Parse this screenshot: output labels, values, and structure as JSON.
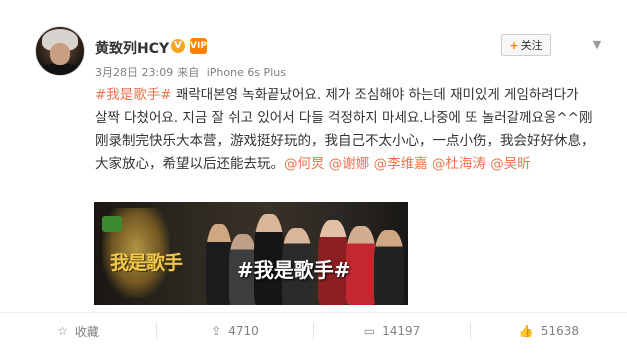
{
  "header": {
    "username": "黄致列HCY",
    "verified_badge": "V",
    "vip_badge": "VIP",
    "timestamp": "3月28日 23:09",
    "source_prefix": "来自",
    "source_device": "iPhone 6s Plus",
    "follow_label": "关注",
    "chevron_icon": "chevron-down-icon"
  },
  "post": {
    "hashtag": "#我是歌手#",
    "korean_text": " 쾌락대본영 녹화끝났어요. 제가 조심해야 하는데 재미있게 게임하려다가 살짝 다쳤어요. 지금 잘 쉬고 있어서 다들 걱정하지 마세요.나중에 또 놀러갈께요옹^^",
    "chinese_text": "刚刚录制完快乐大本营，游戏挺好玩的，我自己不太小心，一点小伤，我会好好休息，大家放心，希望以后还能去玩。",
    "mentions": [
      "@何炅",
      "@谢娜",
      "@李维嘉",
      "@杜海涛",
      "@吴昕"
    ]
  },
  "media": {
    "overlay_hashtag": "#我是歌手#",
    "logo_text": "我是歌手"
  },
  "actions": [
    {
      "label": "收藏",
      "icon": "star-icon"
    },
    {
      "label": "4710",
      "icon": "share-icon"
    },
    {
      "label": "14197",
      "icon": "comment-icon"
    },
    {
      "label": "51638",
      "icon": "like-icon"
    }
  ]
}
